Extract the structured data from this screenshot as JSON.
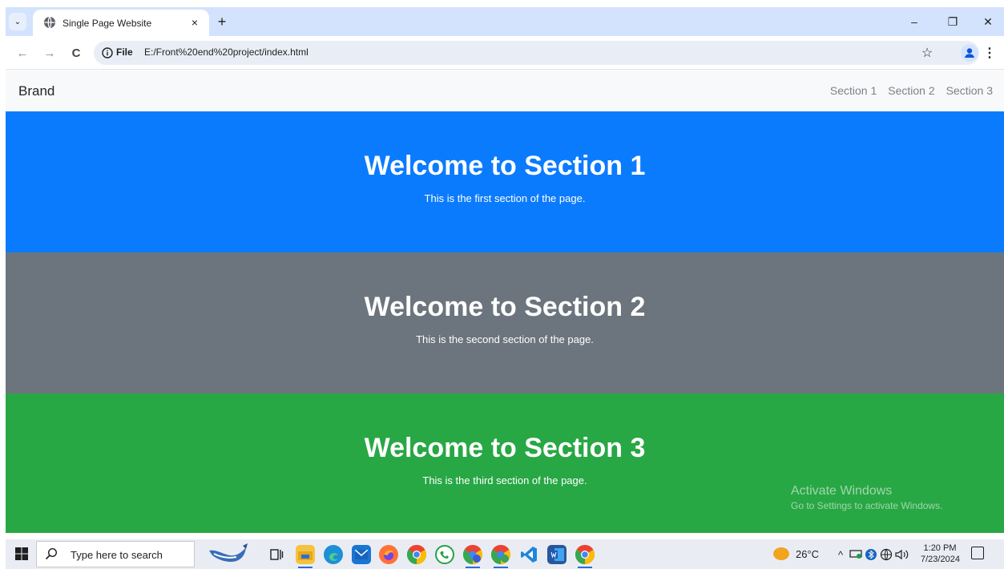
{
  "browser": {
    "tab_title": "Single Page Website",
    "tab_close": "×",
    "new_tab": "+",
    "tab_list": "⌄",
    "minimize": "–",
    "restore": "❐",
    "close": "✕",
    "back": "←",
    "forward": "→",
    "reload": "C",
    "address_chip": "File",
    "url": "E:/Front%20end%20project/index.html",
    "bookmark": "☆",
    "menu": "⋮"
  },
  "page": {
    "brand": "Brand",
    "nav_links": [
      "Section 1",
      "Section 2",
      "Section 3"
    ],
    "sections": [
      {
        "heading": "Welcome to Section 1",
        "text": "This is the first section of the page.",
        "color": "#0b7bfe"
      },
      {
        "heading": "Welcome to Section 2",
        "text": "This is the second section of the page.",
        "color": "#6c757d"
      },
      {
        "heading": "Welcome to Section 3",
        "text": "This is the third section of the page.",
        "color": "#28a745"
      }
    ],
    "watermark": {
      "title": "Activate Windows",
      "subtitle": "Go to Settings to activate Windows."
    }
  },
  "taskbar": {
    "search_placeholder": "Type here to search",
    "icons": [
      "windows-start-icon",
      "task-view-icon",
      "file-explorer-icon",
      "edge-icon",
      "mail-icon",
      "firefox-icon",
      "chrome-icon",
      "whatsapp-icon",
      "chrome-profile-a-icon",
      "chrome-profile-n-icon",
      "vscode-icon",
      "word-icon",
      "chrome-active-icon"
    ],
    "weather": "26°C",
    "tray_chevron": "^",
    "time": "1:20 PM",
    "date": "7/23/2024"
  }
}
